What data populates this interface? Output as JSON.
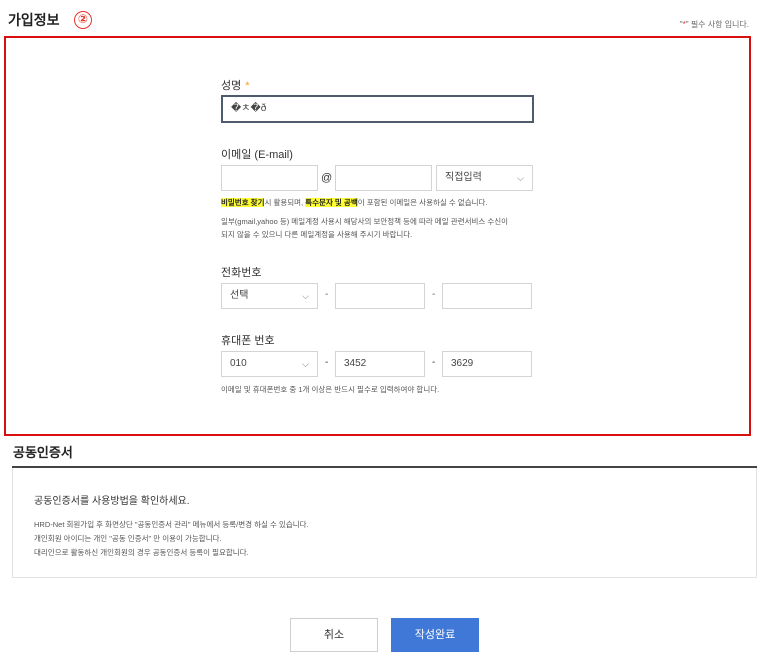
{
  "header": {
    "title": "가입정보",
    "step": "②",
    "required_prefix": "\"",
    "required_star": "*",
    "required_suffix": "\" 필수 사항 입니다."
  },
  "form": {
    "name": {
      "label": "성명",
      "required": "*",
      "value": "�ㅊ�ð"
    },
    "email": {
      "label": "이메일 (E-mail)",
      "local_value": "",
      "at": "@",
      "domain_value": "",
      "select_value": "직접입력",
      "note1_hl1": "비밀번호 찾기",
      "note1_mid": "시 활용되며, ",
      "note1_hl2": "특수문자 및 공백",
      "note1_end": "이 포함된 이메일은 사용하실 수 없습니다.",
      "note2_line1": "일부(gmail,yahoo 등) 메일계정 사용시 해당사의 보안정책 등에 따라 메일 관련서비스 수신이",
      "note2_line2": "되지 않을 수 있으니 다른 메일계정을 사용해 주시기 바랍니다."
    },
    "phone": {
      "label": "전화번호",
      "select_value": "선택",
      "dash": "-",
      "mid_value": "",
      "last_value": ""
    },
    "mobile": {
      "label": "휴대폰 번호",
      "select_value": "010",
      "dash": "-",
      "mid_value": "3452",
      "last_value": "3629",
      "note": "이메일 및 휴대폰번호 중 1개 이상은 반드시 필수로 입력하여야 합니다."
    }
  },
  "certificate": {
    "title": "공동인증서",
    "heading": "공동인증서를 사용방법을 확인하세요.",
    "lines": [
      "HRD-Net 회원가입 후 화면상단 \"공동인증서 관리\" 메뉴에서 등록/변경 하실 수 있습니다.",
      "개인회원 아이디는 개인 \"공동 인증서\" 만 이용이 가능합니다.",
      "대리인으로 활동하신 개인회원의 경우 공동인증서 등록이 필요합니다."
    ]
  },
  "buttons": {
    "cancel": "취소",
    "submit": "작성완료"
  },
  "colors": {
    "highlight_box": "#d90f0f",
    "required_star": "#f0a020",
    "submit_button": "#3f78d6",
    "text_highlight": "#ffff33"
  }
}
